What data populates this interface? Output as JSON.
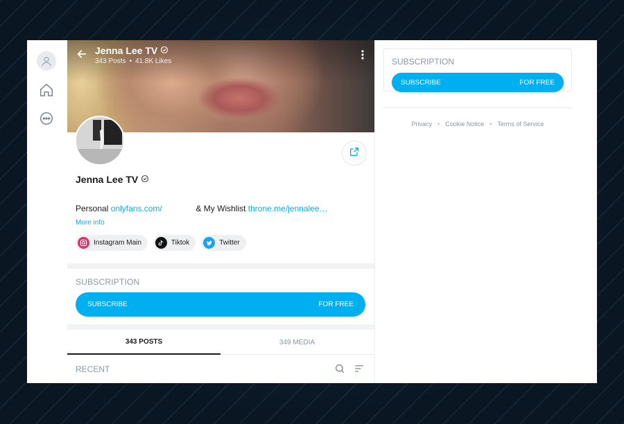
{
  "profile": {
    "name": "Jenna Lee TV",
    "posts_stat": "343 Posts",
    "likes_stat": "41.8K Likes",
    "bio": {
      "prefix": "Personal",
      "link1": "onlyfans.com/",
      "middle": "& My Wishlist",
      "link2": "throne.me/jennalee…"
    },
    "more_info": "More info",
    "socials": [
      {
        "label": "Instagram Main",
        "icon": "instagram-icon",
        "color": "#e1306c"
      },
      {
        "label": "Tiktok",
        "icon": "tiktok-icon",
        "color": "#111111"
      },
      {
        "label": "Twitter",
        "icon": "twitter-icon",
        "color": "#1da1f2"
      }
    ]
  },
  "subscription": {
    "label": "SUBSCRIPTION",
    "button_left": "SUBSCRIBE",
    "button_right": "FOR FREE"
  },
  "tabs": [
    {
      "label": "343 POSTS",
      "active": true
    },
    {
      "label": "349 MEDIA",
      "active": false
    }
  ],
  "recent": {
    "label": "RECENT"
  },
  "sidebar_subscription": {
    "label": "SUBSCRIPTION",
    "button_left": "SUBSCRIBE",
    "button_right": "FOR FREE"
  },
  "footer_links": [
    "Privacy",
    "Cookie Notice",
    "Terms of Service"
  ],
  "colors": {
    "accent": "#00aff0",
    "muted": "#8a96a3"
  }
}
